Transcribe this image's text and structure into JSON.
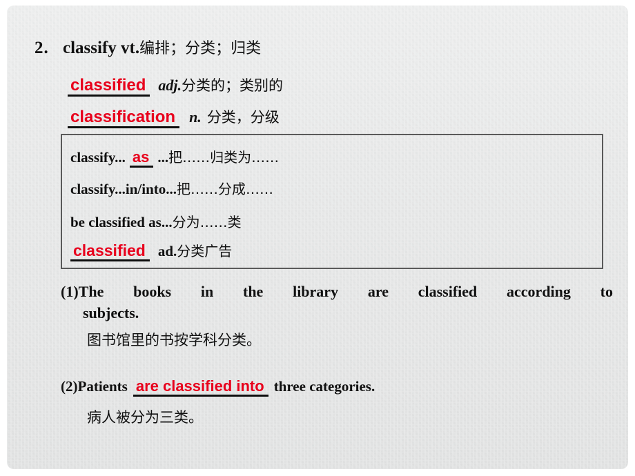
{
  "slide": {
    "background_color": "#e7e8e8",
    "answer_color": "#e8001c",
    "text_color": "#111111",
    "box_border_color": "#5a5a5a"
  },
  "headword": {
    "number": "2.",
    "word": "classify vt.",
    "chinese": "编排；分类；归类"
  },
  "derivatives": [
    {
      "answer": "classified",
      "pos": "adj.",
      "chinese": "分类的；类别的"
    },
    {
      "answer": "classification",
      "pos": "n.",
      "chinese": "分类，分级"
    }
  ],
  "phrase_box": {
    "lines": [
      {
        "before": "classify...",
        "answer": "as",
        "after": "...",
        "chinese": "把……归类为……"
      },
      {
        "before": "classify...in/into...",
        "answer": "",
        "after": "",
        "chinese": "把……分成……"
      },
      {
        "before": "be classified as...",
        "answer": "",
        "after": "",
        "chinese": "分为……类"
      },
      {
        "before": "",
        "answer": "classified",
        "after": "ad.",
        "chinese": "分类广告"
      }
    ]
  },
  "examples": [
    {
      "marker": "(1)",
      "sentence_head": "The books in the library are classified according to",
      "sentence_tail": "subjects.",
      "translation": "图书馆里的书按学科分类。"
    },
    {
      "marker": "(2)",
      "before": "Patients",
      "answer": "are classified into",
      "after": "three categories.",
      "translation": "病人被分为三类。"
    }
  ]
}
